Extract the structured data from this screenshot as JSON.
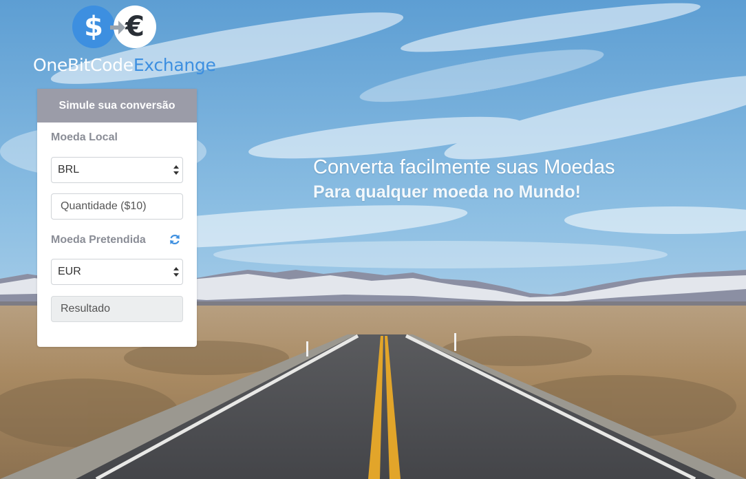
{
  "brand": {
    "name_part1": "OneBitCode",
    "name_part2": "Exchange",
    "dollar_symbol": "$",
    "euro_symbol": "€",
    "accent_color": "#3d8fe0"
  },
  "card": {
    "header": "Simule sua conversão",
    "local_label": "Moeda Local",
    "local_value": "BRL",
    "amount_placeholder": "Quantidade ($10)",
    "target_label": "Moeda Pretendida",
    "target_value": "EUR",
    "result_placeholder": "Resultado",
    "refresh_icon": "refresh-icon"
  },
  "hero": {
    "title": "Converta facilmente suas Moedas",
    "subtitle": "Para qualquer moeda no Mundo!"
  }
}
